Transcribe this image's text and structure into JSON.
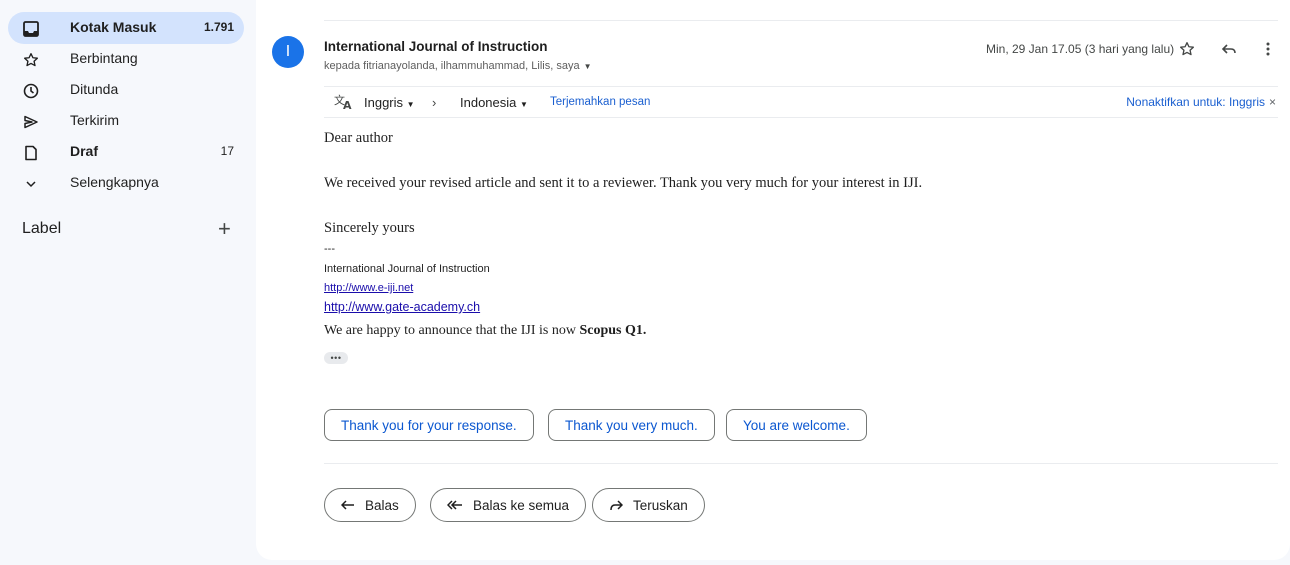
{
  "sidebar": {
    "items": [
      {
        "label": "Kotak Masuk",
        "count": "1.791",
        "icon": "inbox-icon"
      },
      {
        "label": "Berbintang",
        "count": "",
        "icon": "star-icon"
      },
      {
        "label": "Ditunda",
        "count": "",
        "icon": "clock-icon"
      },
      {
        "label": "Terkirim",
        "count": "",
        "icon": "send-icon"
      },
      {
        "label": "Draf",
        "count": "17",
        "icon": "draft-icon"
      },
      {
        "label": "Selengkapnya",
        "count": "",
        "icon": "chevron-down-icon"
      }
    ],
    "labels_heading": "Label",
    "add_symbol": "+"
  },
  "email": {
    "avatar_letter": "I",
    "sender": "International Journal of Instruction",
    "recipients": "kepada fitrianayolanda, ilhammuhammad, Lilis, saya",
    "date": "Min, 29 Jan 17.05 (3 hari yang lalu)",
    "translate": {
      "from": "Inggris",
      "to": "Indonesia",
      "translate_link": "Terjemahkan pesan",
      "disable": "Nonaktifkan untuk: Inggris"
    },
    "body": {
      "greeting": "Dear author",
      "paragraph": "We received your revised article and sent it to a reviewer. Thank you very much for your interest in IJI.",
      "closing": "Sincerely yours",
      "separator": "---",
      "sig_name": "International Journal of Instruction",
      "link1": "http://www.e-iji.net",
      "link2": "http://www.gate-academy.ch",
      "announce_prefix": "We are happy to announce that the IJI is now ",
      "announce_bold": "Scopus Q1."
    },
    "ellipsis": "•••",
    "smart_replies": [
      "Thank you for your response.",
      "Thank you very much.",
      "You are welcome."
    ],
    "actions": {
      "reply": "Balas",
      "reply_all": "Balas ke semua",
      "forward": "Teruskan"
    }
  },
  "colors": {
    "accent": "#0b57d0",
    "active_nav": "#d3e3fd",
    "avatar": "#1a73e8",
    "background": "#f6f8fc"
  }
}
